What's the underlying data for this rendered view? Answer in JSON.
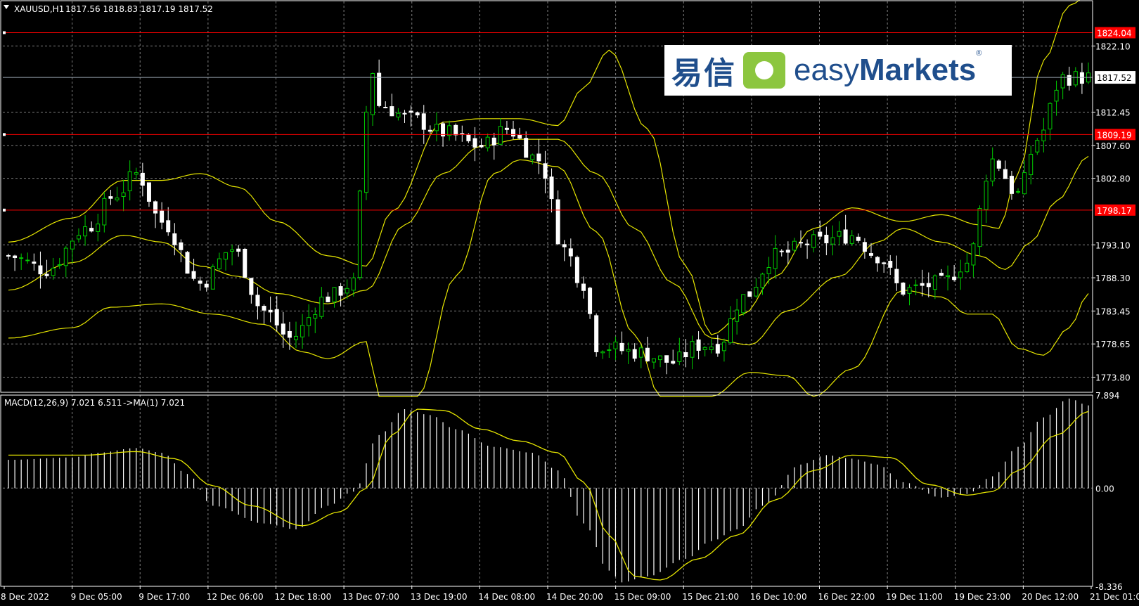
{
  "window": {
    "title_symbol": "XAUUSD,H1",
    "ohlc": "1817.56 1818.83 1817.19 1817.52",
    "macd_label": "MACD(12,26,9) 7.021 6.511",
    "macd_ma_label": "->MA(1) 7.021"
  },
  "logo": {
    "cn": "易信",
    "en_light": "easy",
    "en_bold": "Markets",
    "reg": "®"
  },
  "colors": {
    "background": "#000000",
    "bull": "#00cc00",
    "bear": "#ffffff",
    "bands": "#e6e600",
    "hline": "#ff0000",
    "grid": "#7f7f7f",
    "text": "#ffffff",
    "current_price_tag": "#ffffff"
  },
  "chart_data": [
    {
      "type": "line",
      "title": "XAUUSD,H1",
      "y_range": [
        1771.6,
        1828.6
      ],
      "y_ticks": [
        "1822.10",
        "1812.45",
        "1807.60",
        "1802.80",
        "1793.10",
        "1788.30",
        "1783.45",
        "1778.65",
        "1773.80"
      ],
      "horizontal_lines": [
        {
          "label": "1824.04",
          "value": 1824.04
        },
        {
          "label": "1809.19",
          "value": 1809.19
        },
        {
          "label": "1798.17",
          "value": 1798.17
        }
      ],
      "current_price": {
        "label": "1817.52",
        "value": 1817.52
      },
      "x_labels": [
        "8 Dec 2022",
        "9 Dec 05:00",
        "9 Dec 17:00",
        "12 Dec 06:00",
        "12 Dec 18:00",
        "13 Dec 07:00",
        "13 Dec 19:00",
        "14 Dec 08:00",
        "14 Dec 20:00",
        "15 Dec 09:00",
        "15 Dec 21:00",
        "16 Dec 10:00",
        "16 Dec 22:00",
        "19 Dec 11:00",
        "19 Dec 23:00",
        "20 Dec 12:00",
        "21 Dec 01:00"
      ],
      "price_keypoints": [
        [
          0,
          1791.5
        ],
        [
          6,
          1789.5
        ],
        [
          12,
          1795.5
        ],
        [
          17,
          1800.5
        ],
        [
          20,
          1803.5
        ],
        [
          24,
          1796.5
        ],
        [
          30,
          1787.5
        ],
        [
          35,
          1792.5
        ],
        [
          40,
          1783.5
        ],
        [
          44,
          1779.5
        ],
        [
          50,
          1785.5
        ],
        [
          54,
          1787.5
        ],
        [
          56,
          1812.5
        ],
        [
          57,
          1818.5
        ],
        [
          58,
          1813.5
        ],
        [
          63,
          1811.5
        ],
        [
          68,
          1809.5
        ],
        [
          74,
          1807.5
        ],
        [
          78,
          1810.0
        ],
        [
          83,
          1805.5
        ],
        [
          87,
          1792.5
        ],
        [
          90,
          1787.5
        ],
        [
          92,
          1778.5
        ],
        [
          98,
          1777.5
        ],
        [
          104,
          1776.0
        ],
        [
          108,
          1778.5
        ],
        [
          111,
          1778.5
        ],
        [
          115,
          1785.5
        ],
        [
          120,
          1791.5
        ],
        [
          126,
          1793.5
        ],
        [
          132,
          1794.5
        ],
        [
          136,
          1791.5
        ],
        [
          140,
          1786.5
        ],
        [
          146,
          1787.5
        ],
        [
          150,
          1790.5
        ],
        [
          154,
          1805.5
        ],
        [
          158,
          1800.5
        ],
        [
          161,
          1808.5
        ],
        [
          165,
          1817.5
        ],
        [
          169,
          1817.52
        ]
      ],
      "upper_band_keypoints": [
        [
          0,
          1793.5
        ],
        [
          10,
          1797.0
        ],
        [
          18,
          1802.5
        ],
        [
          24,
          1802.5
        ],
        [
          30,
          1803.5
        ],
        [
          36,
          1801.5
        ],
        [
          42,
          1796.5
        ],
        [
          50,
          1791.5
        ],
        [
          56,
          1790.0
        ],
        [
          60,
          1798.0
        ],
        [
          68,
          1811.0
        ],
        [
          74,
          1811.5
        ],
        [
          80,
          1811.5
        ],
        [
          86,
          1810.5
        ],
        [
          90,
          1816.0
        ],
        [
          94,
          1821.5
        ],
        [
          100,
          1810.0
        ],
        [
          106,
          1790.0
        ],
        [
          110,
          1780.0
        ],
        [
          115,
          1783.0
        ],
        [
          120,
          1788.5
        ],
        [
          126,
          1795.5
        ],
        [
          132,
          1798.5
        ],
        [
          140,
          1796.5
        ],
        [
          146,
          1797.5
        ],
        [
          152,
          1796.0
        ],
        [
          155,
          1795.5
        ],
        [
          158,
          1803.5
        ],
        [
          162,
          1820.0
        ],
        [
          166,
          1828.0
        ],
        [
          169,
          1829.5
        ]
      ],
      "middle_band_keypoints": [
        [
          0,
          1786.5
        ],
        [
          10,
          1790.5
        ],
        [
          18,
          1794.5
        ],
        [
          24,
          1793.5
        ],
        [
          30,
          1790.0
        ],
        [
          36,
          1788.5
        ],
        [
          42,
          1786.0
        ],
        [
          50,
          1784.5
        ],
        [
          56,
          1786.5
        ],
        [
          62,
          1796.0
        ],
        [
          68,
          1803.5
        ],
        [
          74,
          1807.5
        ],
        [
          80,
          1808.5
        ],
        [
          86,
          1808.5
        ],
        [
          92,
          1803.5
        ],
        [
          98,
          1795.5
        ],
        [
          104,
          1787.5
        ],
        [
          110,
          1779.5
        ],
        [
          116,
          1778.5
        ],
        [
          122,
          1783.5
        ],
        [
          130,
          1788.5
        ],
        [
          136,
          1793.5
        ],
        [
          140,
          1795.5
        ],
        [
          146,
          1793.5
        ],
        [
          152,
          1791.5
        ],
        [
          156,
          1789.5
        ],
        [
          160,
          1793.5
        ],
        [
          164,
          1799.5
        ],
        [
          169,
          1806.0
        ]
      ],
      "lower_band_keypoints": [
        [
          0,
          1779.5
        ],
        [
          10,
          1781.0
        ],
        [
          16,
          1784.0
        ],
        [
          24,
          1784.5
        ],
        [
          32,
          1783.0
        ],
        [
          40,
          1781.5
        ],
        [
          46,
          1777.5
        ],
        [
          50,
          1776.5
        ],
        [
          56,
          1779.0
        ],
        [
          58,
          1771.0
        ],
        [
          64,
          1771.0
        ],
        [
          70,
          1788.5
        ],
        [
          76,
          1803.5
        ],
        [
          80,
          1805.5
        ],
        [
          86,
          1804.5
        ],
        [
          92,
          1795.0
        ],
        [
          98,
          1780.0
        ],
        [
          102,
          1771.0
        ],
        [
          110,
          1771.0
        ],
        [
          116,
          1774.5
        ],
        [
          122,
          1774.0
        ],
        [
          126,
          1771.0
        ],
        [
          132,
          1775.0
        ],
        [
          140,
          1786.5
        ],
        [
          146,
          1785.5
        ],
        [
          150,
          1783.0
        ],
        [
          154,
          1783.0
        ],
        [
          158,
          1778.0
        ],
        [
          162,
          1777.0
        ],
        [
          166,
          1781.0
        ],
        [
          169,
          1786.0
        ]
      ]
    },
    {
      "type": "bar",
      "title": "MACD(12,26,9)",
      "y_range": [
        -8.336,
        7.894
      ],
      "y_ticks": [
        "7.894",
        "0.00",
        "-8.336"
      ],
      "histogram_keypoints": [
        [
          0,
          2.4
        ],
        [
          10,
          2.6
        ],
        [
          14,
          3.0
        ],
        [
          20,
          3.4
        ],
        [
          24,
          3.0
        ],
        [
          28,
          1.2
        ],
        [
          32,
          -1.5
        ],
        [
          40,
          -3.0
        ],
        [
          45,
          -3.5
        ],
        [
          50,
          -1.5
        ],
        [
          54,
          -0.3
        ],
        [
          58,
          4.5
        ],
        [
          62,
          6.7
        ],
        [
          66,
          6.2
        ],
        [
          70,
          5.0
        ],
        [
          76,
          3.5
        ],
        [
          82,
          3.0
        ],
        [
          86,
          1.5
        ],
        [
          90,
          -3.0
        ],
        [
          94,
          -7.0
        ],
        [
          96,
          -8.0
        ],
        [
          100,
          -7.5
        ],
        [
          106,
          -6.0
        ],
        [
          110,
          -4.5
        ],
        [
          114,
          -3.5
        ],
        [
          118,
          -1.5
        ],
        [
          124,
          2.0
        ],
        [
          128,
          2.8
        ],
        [
          132,
          2.5
        ],
        [
          136,
          2.0
        ],
        [
          140,
          0.5
        ],
        [
          146,
          -0.8
        ],
        [
          150,
          -0.5
        ],
        [
          154,
          1.0
        ],
        [
          158,
          3.5
        ],
        [
          162,
          6.0
        ],
        [
          166,
          7.6
        ],
        [
          169,
          7.021
        ]
      ],
      "signal_keypoints": [
        [
          0,
          2.8
        ],
        [
          12,
          2.8
        ],
        [
          20,
          3.1
        ],
        [
          26,
          2.5
        ],
        [
          32,
          0.2
        ],
        [
          38,
          -1.5
        ],
        [
          46,
          -3.2
        ],
        [
          52,
          -2.0
        ],
        [
          56,
          0.0
        ],
        [
          60,
          4.5
        ],
        [
          64,
          6.7
        ],
        [
          68,
          6.6
        ],
        [
          74,
          5.0
        ],
        [
          80,
          4.0
        ],
        [
          86,
          3.0
        ],
        [
          90,
          0.5
        ],
        [
          94,
          -4.0
        ],
        [
          98,
          -7.5
        ],
        [
          102,
          -7.8
        ],
        [
          108,
          -6.0
        ],
        [
          114,
          -4.0
        ],
        [
          120,
          -1.0
        ],
        [
          126,
          1.5
        ],
        [
          132,
          2.8
        ],
        [
          138,
          2.6
        ],
        [
          144,
          0.3
        ],
        [
          150,
          -0.6
        ],
        [
          154,
          -0.3
        ],
        [
          158,
          1.5
        ],
        [
          164,
          4.5
        ],
        [
          169,
          6.511
        ]
      ]
    }
  ]
}
